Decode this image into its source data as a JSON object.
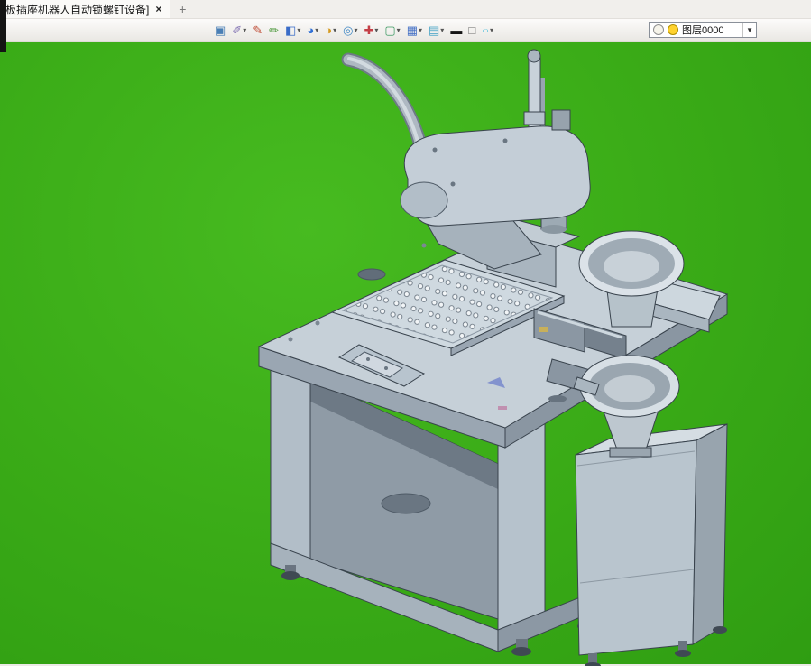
{
  "tab": {
    "title": "板插座机器人自动锁螺钉设备]",
    "close_label": "×"
  },
  "new_tab_label": "+",
  "toolbar": {
    "buttons": [
      {
        "name": "view-window",
        "glyph": "▣",
        "color": "#4a7fb5",
        "dropdown": false
      },
      {
        "name": "eyedropper",
        "glyph": "✐",
        "color": "#7d6db0",
        "dropdown": true
      },
      {
        "name": "pen",
        "glyph": "✎",
        "color": "#c0503a",
        "dropdown": false
      },
      {
        "name": "brush",
        "glyph": "✏",
        "color": "#4f9a3f",
        "dropdown": false
      },
      {
        "name": "solid-cube",
        "glyph": "◧",
        "color": "#3a6cc8",
        "dropdown": true
      },
      {
        "name": "paint-sphere",
        "glyph": "◕",
        "color": "#2f6fd6",
        "dropdown": true
      },
      {
        "name": "color-wheel",
        "glyph": "◑",
        "color": "#d59a20",
        "dropdown": true
      },
      {
        "name": "zoom",
        "glyph": "◎",
        "color": "#3f87c4",
        "dropdown": true
      },
      {
        "name": "locate",
        "glyph": "✚",
        "color": "#c43f46",
        "dropdown": true
      },
      {
        "name": "frame-select",
        "glyph": "▢",
        "color": "#3f9a64",
        "dropdown": true
      },
      {
        "name": "axis-grid",
        "glyph": "▦",
        "color": "#3f6cc4",
        "dropdown": true
      },
      {
        "name": "display-mode",
        "glyph": "▤",
        "color": "#3fa0c4",
        "dropdown": true
      },
      {
        "name": "line-width",
        "glyph": "▬",
        "color": "#151515",
        "dropdown": false
      },
      {
        "name": "color-swatch",
        "glyph": "□",
        "color": "#6a6a6a",
        "dropdown": false
      },
      {
        "name": "ellipse-style",
        "glyph": "○",
        "color": "#2fb4d8",
        "dropdown": true
      }
    ],
    "layer": {
      "value": "图层0000",
      "caret": "▼"
    }
  },
  "colors": {
    "viewport_green": "#3aa916",
    "machine_light": "#c6d0d8",
    "machine_mid": "#a8b4c0",
    "machine_dark": "#6e7a86"
  }
}
